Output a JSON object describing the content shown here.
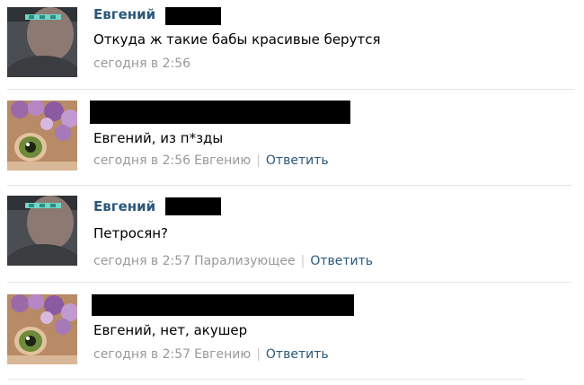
{
  "comments": [
    {
      "author": "Евгений",
      "text": "Откуда ж такие бабы красивые берутся",
      "time": "сегодня в 2:56",
      "reply_to": "",
      "reply_label": ""
    },
    {
      "author": "",
      "text": "Евгений, из п*зды",
      "time": "сегодня в 2:56",
      "reply_to": "Евгению",
      "reply_label": "Ответить"
    },
    {
      "author": "Евгений",
      "text": "Петросян?",
      "time": "сегодня в 2:57",
      "reply_to": "Парализующее",
      "reply_label": "Ответить"
    },
    {
      "author": "",
      "text": "Евгений, нет, акушер",
      "time": "сегодня в 2:57",
      "reply_to": "Евгению",
      "reply_label": "Ответить"
    }
  ],
  "colors": {
    "link": "#2b587a",
    "meta": "#999999",
    "redaction": "#000000"
  },
  "icons": {
    "avatar_a": "man-avatar",
    "avatar_b": "cat-flowers-avatar"
  }
}
